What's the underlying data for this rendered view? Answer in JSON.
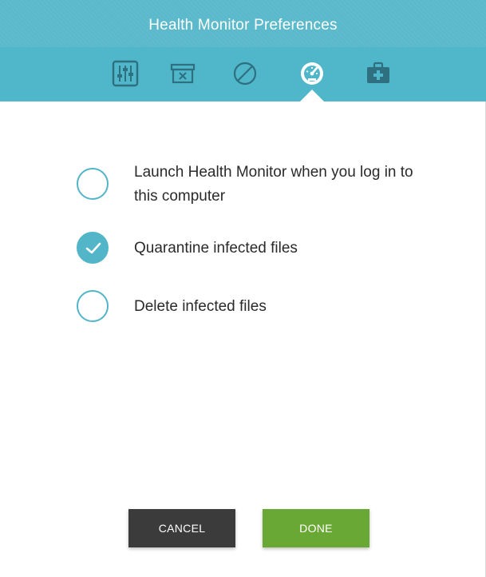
{
  "window": {
    "title": "Health Monitor Preferences"
  },
  "toolbar": {
    "tabs": [
      {
        "icon": "sliders-icon",
        "active": false
      },
      {
        "icon": "archive-box-icon",
        "active": false
      },
      {
        "icon": "block-icon",
        "active": false
      },
      {
        "icon": "speedometer-icon",
        "active": true
      },
      {
        "icon": "medical-kit-icon",
        "active": false
      }
    ]
  },
  "options": [
    {
      "label": "Launch Health Monitor when you log in to this computer",
      "checked": false
    },
    {
      "label": "Quarantine infected files",
      "checked": true
    },
    {
      "label": "Delete infected files",
      "checked": false
    }
  ],
  "buttons": {
    "cancel_label": "CANCEL",
    "done_label": "DONE"
  },
  "colors": {
    "header": "#4fb7c9",
    "accent": "#52b5c8",
    "cancel": "#3b3b3b",
    "done": "#6aa836"
  }
}
